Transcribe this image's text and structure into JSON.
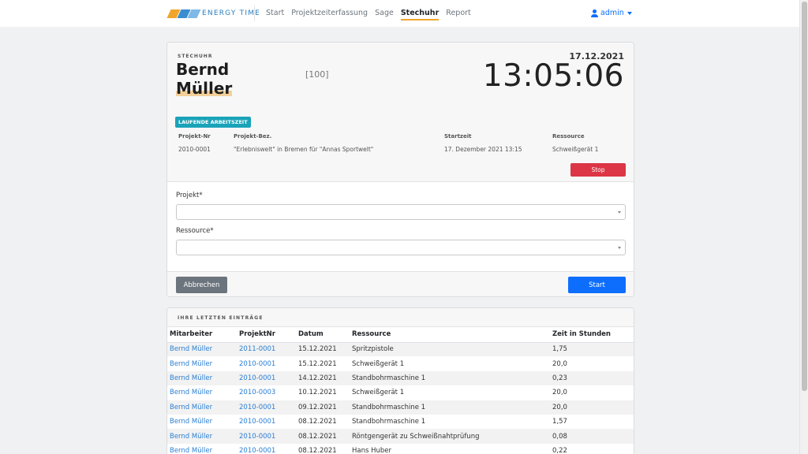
{
  "nav": {
    "brand": "ENERGY TIME",
    "links": [
      {
        "label": "Start",
        "active": false
      },
      {
        "label": "Projektzeiterfassung",
        "active": false
      },
      {
        "label": "Sage",
        "active": false
      },
      {
        "label": "Stechuhr",
        "active": true
      },
      {
        "label": "Report",
        "active": false
      }
    ],
    "user": "admin",
    "user_icon": "user-icon",
    "accent": "#f0a52b"
  },
  "clock_card": {
    "eyebrow": "STECHUHR",
    "employee_name": "Bernd Müller",
    "employee_id": "[100]",
    "date": "17.12.2021",
    "time": "13:05:06",
    "running_badge": "LAUFENDE ARBEITSZEIT",
    "running_headers": [
      "Projekt-Nr",
      "Projekt-Bez.",
      "Startzeit",
      "Ressource"
    ],
    "running_values": [
      "2010-0001",
      "\"Erlebniswelt\" in Bremen für \"Annas Sportwelt\"",
      "17. Dezember 2021 13:15",
      "Schweißgerät 1"
    ],
    "stop_label": "Stop",
    "project_label": "Projekt*",
    "project_value": "",
    "resource_label": "Ressource*",
    "resource_value": "",
    "cancel_label": "Abbrechen",
    "start_label": "Start"
  },
  "entries": {
    "title": "IHRE LETZTEN EINTRÄGE",
    "columns": [
      "Mitarbeiter",
      "ProjektNr",
      "Datum",
      "Ressource",
      "Zeit in Stunden"
    ],
    "rows": [
      [
        "Bernd Müller",
        "2011-0001",
        "15.12.2021",
        "Spritzpistole",
        "1,75"
      ],
      [
        "Bernd Müller",
        "2010-0001",
        "15.12.2021",
        "Schweißgerät 1",
        "20,0"
      ],
      [
        "Bernd Müller",
        "2010-0001",
        "14.12.2021",
        "Standbohrmaschine 1",
        "0,23"
      ],
      [
        "Bernd Müller",
        "2010-0003",
        "10.12.2021",
        "Schweißgerät 1",
        "20,0"
      ],
      [
        "Bernd Müller",
        "2010-0001",
        "09.12.2021",
        "Standbohrmaschine 1",
        "20,0"
      ],
      [
        "Bernd Müller",
        "2010-0001",
        "08.12.2021",
        "Standbohrmaschine 1",
        "1,57"
      ],
      [
        "Bernd Müller",
        "2010-0001",
        "08.12.2021",
        "Röntgengerät zu Schweißnahtprüfung",
        "0,08"
      ],
      [
        "Bernd Müller",
        "2010-0001",
        "08.12.2021",
        "Hans Huber",
        "0,22"
      ]
    ]
  }
}
